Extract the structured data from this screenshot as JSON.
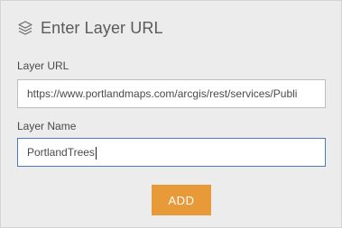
{
  "header": {
    "icon": "layers-icon",
    "title": "Enter Layer URL"
  },
  "form": {
    "url_label": "Layer URL",
    "url_value": "https://www.portlandmaps.com/arcgis/rest/services/Publi",
    "name_label": "Layer Name",
    "name_value": "PortlandTrees"
  },
  "actions": {
    "add_label": "ADD"
  },
  "colors": {
    "add_button": "#e89a38",
    "focused_border": "#4a7ab7"
  }
}
